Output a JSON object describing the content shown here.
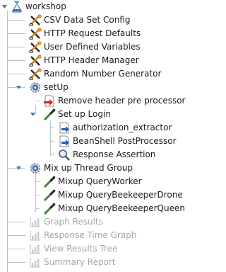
{
  "tree": {
    "root": {
      "label": "workshop",
      "icon": "test-plan-flask-icon"
    },
    "config_elements": [
      {
        "label": "CSV Data Set Config",
        "icon": "wrench-scissors-icon"
      },
      {
        "label": "HTTP Request Defaults",
        "icon": "wrench-scissors-icon"
      },
      {
        "label": "User Defined Variables",
        "icon": "wrench-scissors-icon"
      },
      {
        "label": "HTTP Header Manager",
        "icon": "wrench-scissors-icon"
      },
      {
        "label": "Random Number Generator",
        "icon": "wrench-scissors-icon"
      }
    ],
    "setup": {
      "label": "setUp",
      "icon": "thread-group-gear-icon",
      "pre_processor": {
        "label": "Remove header pre processor",
        "icon": "pre-processor-icon"
      },
      "sampler": {
        "label": "Set up Login",
        "icon": "sampler-pipette-icon"
      },
      "children": [
        {
          "label": "authorization_extractor",
          "icon": "post-processor-icon"
        },
        {
          "label": "BeanShell PostProcessor",
          "icon": "post-processor-icon"
        },
        {
          "label": "Response Assertion",
          "icon": "assertion-magnifier-icon"
        }
      ]
    },
    "mixup": {
      "label": "Mix up Thread Group",
      "icon": "thread-group-gear-icon",
      "samplers": [
        {
          "label": "Mixup QueryWorker",
          "icon": "sampler-pipette-icon"
        },
        {
          "label": "Mixup QueryBeekeeperDrone",
          "icon": "sampler-pipette-icon"
        },
        {
          "label": "Mixup QueryBeekeeperQueen",
          "icon": "sampler-pipette-icon"
        }
      ]
    },
    "listeners": [
      {
        "label": "Graph Results",
        "icon": "graph-listener-icon"
      },
      {
        "label": "Response Time Graph",
        "icon": "graph-listener-icon"
      },
      {
        "label": "View Results Tree",
        "icon": "graph-listener-icon"
      },
      {
        "label": "Summary Report",
        "icon": "graph-listener-icon"
      }
    ],
    "listener_state": "disabled"
  },
  "colors": {
    "tree_line": "#b8c3cc",
    "toggle": "#4a7aa8",
    "disabled_text": "#a7a7a7"
  }
}
